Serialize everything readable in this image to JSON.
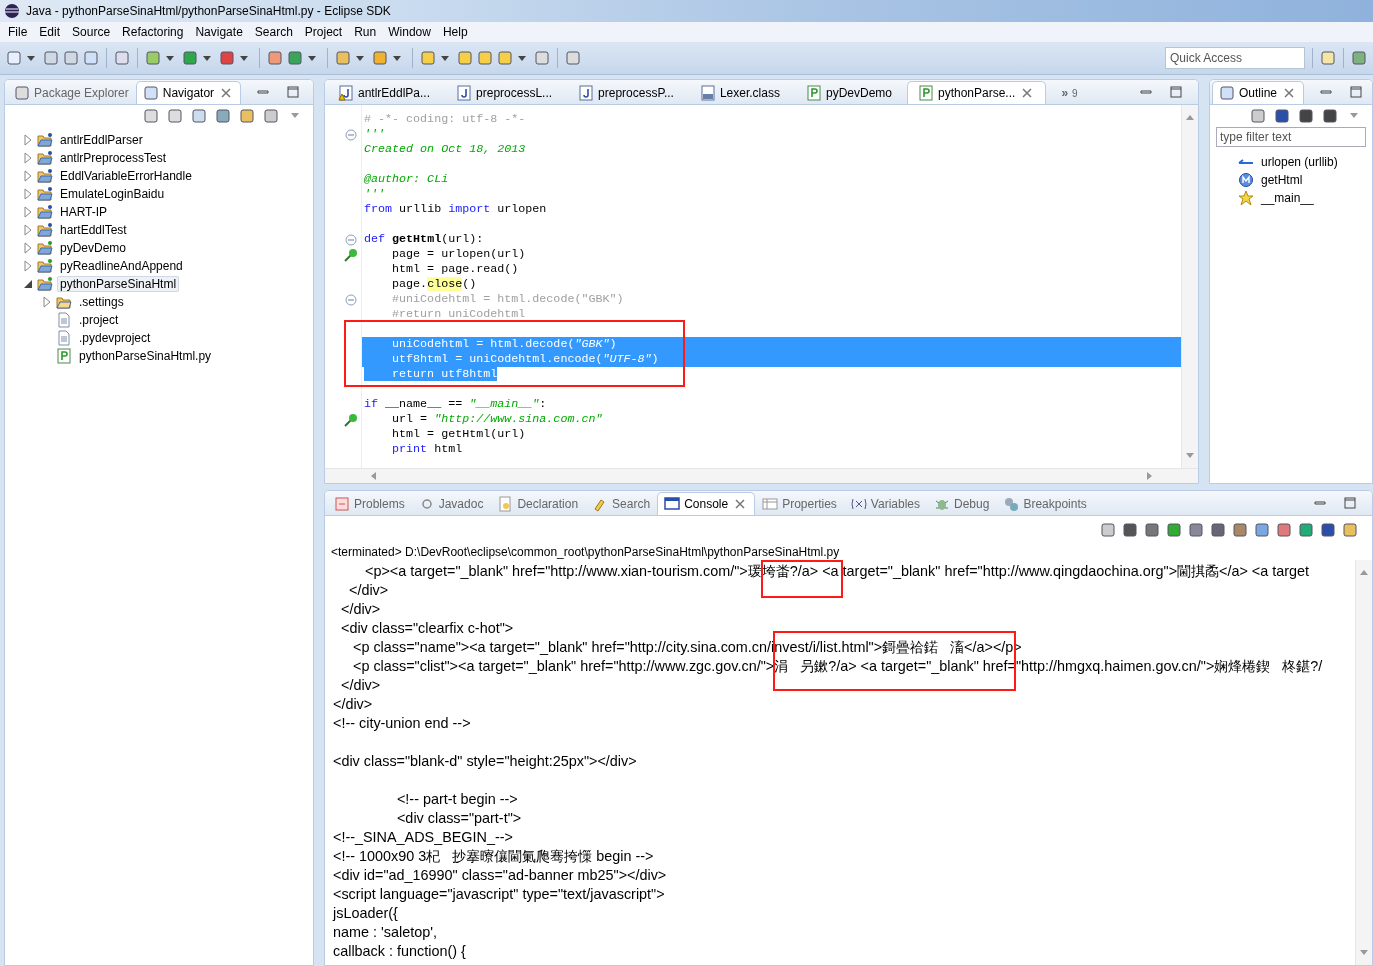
{
  "window": {
    "title": "Java - pythonParseSinaHtml/pythonParseSinaHtml.py - Eclipse SDK"
  },
  "menu": [
    "File",
    "Edit",
    "Source",
    "Refactoring",
    "Navigate",
    "Search",
    "Project",
    "Run",
    "Window",
    "Help"
  ],
  "quick_access": {
    "placeholder": "Quick Access"
  },
  "left_panel": {
    "tabs": [
      {
        "label": "Package Explorer",
        "selected": false
      },
      {
        "label": "Navigator",
        "selected": true
      }
    ],
    "tree": [
      {
        "label": "antlrEddlParser",
        "kind": "java-project",
        "expanded": false,
        "selected": false
      },
      {
        "label": "antlrPreprocessTest",
        "kind": "java-project",
        "expanded": false,
        "selected": false
      },
      {
        "label": "EddlVariableErrorHandle",
        "kind": "java-project",
        "expanded": false,
        "selected": false
      },
      {
        "label": "EmulateLoginBaidu",
        "kind": "java-project",
        "expanded": false,
        "selected": false
      },
      {
        "label": "HART-IP",
        "kind": "c-project",
        "expanded": false,
        "selected": false
      },
      {
        "label": "hartEddlTest",
        "kind": "java-project",
        "expanded": false,
        "selected": false
      },
      {
        "label": "pyDevDemo",
        "kind": "py-project",
        "expanded": false,
        "selected": false
      },
      {
        "label": "pyReadlineAndAppend",
        "kind": "py-project",
        "expanded": false,
        "selected": false
      },
      {
        "label": "pythonParseSinaHtml",
        "kind": "py-project",
        "expanded": true,
        "selected": true,
        "children": [
          {
            "label": ".settings",
            "kind": "folder",
            "expanded": false,
            "selected": false
          },
          {
            "label": ".project",
            "kind": "file",
            "selected": false
          },
          {
            "label": ".pydevproject",
            "kind": "file",
            "selected": false
          },
          {
            "label": "pythonParseSinaHtml.py",
            "kind": "py-file",
            "selected": false
          }
        ]
      }
    ]
  },
  "editor": {
    "tabs": [
      {
        "label": "antlrEddlPa...",
        "kind": "java-warn",
        "selected": false
      },
      {
        "label": "preprocessL...",
        "kind": "java",
        "selected": false
      },
      {
        "label": "preprocessP...",
        "kind": "java",
        "selected": false
      },
      {
        "label": "Lexer.class",
        "kind": "class",
        "selected": false
      },
      {
        "label": "pyDevDemo",
        "kind": "py",
        "selected": false
      },
      {
        "label": "pythonParse...",
        "kind": "py",
        "selected": true
      }
    ],
    "overflow": {
      "mark": "»",
      "count": "9"
    },
    "lines": [
      {
        "kind": "code",
        "selected": false,
        "segments": [
          {
            "text": "# -*- coding: utf-8 -*-",
            "kind": "comment"
          }
        ]
      },
      {
        "kind": "code",
        "selected": false,
        "gutter": {
          "kind": "fold"
        },
        "segments": [
          {
            "text": "'''",
            "kind": "docstring"
          }
        ]
      },
      {
        "kind": "code",
        "selected": false,
        "segments": [
          {
            "text": "Created on Oct 18, 2013",
            "kind": "docstring"
          }
        ]
      },
      {
        "kind": "blank"
      },
      {
        "kind": "code",
        "selected": false,
        "segments": [
          {
            "text": "@author: CLi",
            "kind": "docstring"
          }
        ]
      },
      {
        "kind": "code",
        "selected": false,
        "segments": [
          {
            "text": "'''",
            "kind": "docstring"
          }
        ]
      },
      {
        "kind": "code",
        "selected": false,
        "segments": [
          {
            "text": "from",
            "kind": "keyword"
          },
          {
            "text": " urllib ",
            "kind": "plain"
          },
          {
            "text": "import",
            "kind": "keyword"
          },
          {
            "text": " urlopen",
            "kind": "plain"
          }
        ]
      },
      {
        "kind": "blank"
      },
      {
        "kind": "code",
        "selected": false,
        "gutter": {
          "kind": "fold"
        },
        "segments": [
          {
            "text": "def ",
            "kind": "keyword"
          },
          {
            "text": "getHtml",
            "kind": "name"
          },
          {
            "text": "(url):",
            "kind": "plain"
          }
        ]
      },
      {
        "kind": "code",
        "selected": false,
        "gutter": {
          "kind": "marker"
        },
        "segments": [
          {
            "text": "    page = urlopen(url)",
            "kind": "plain"
          }
        ]
      },
      {
        "kind": "code",
        "selected": false,
        "segments": [
          {
            "text": "    html = page.read()",
            "kind": "plain"
          }
        ]
      },
      {
        "kind": "code",
        "selected": false,
        "segments": [
          {
            "text": "    page.",
            "kind": "plain"
          },
          {
            "text": "close",
            "kind": "occurrence"
          },
          {
            "text": "()",
            "kind": "plain"
          }
        ]
      },
      {
        "kind": "code",
        "selected": false,
        "gutter": {
          "kind": "fold"
        },
        "segments": [
          {
            "text": "    #uniCodehtml = html.decode(\"GBK\")",
            "kind": "comment"
          }
        ]
      },
      {
        "kind": "code",
        "selected": false,
        "segments": [
          {
            "text": "    #return uniCodehtml",
            "kind": "comment"
          }
        ]
      },
      {
        "kind": "blank"
      },
      {
        "kind": "code",
        "selected": true,
        "segments": [
          {
            "text": "    uniCodehtml = html.decode(",
            "kind": "plain"
          },
          {
            "text": "\"GBK\"",
            "kind": "string"
          },
          {
            "text": ")",
            "kind": "plain"
          }
        ]
      },
      {
        "kind": "code",
        "selected": true,
        "segments": [
          {
            "text": "    utf8html = uniCodehtml.encode(",
            "kind": "plain"
          },
          {
            "text": "\"UTF-8\"",
            "kind": "string"
          },
          {
            "text": ")",
            "kind": "plain"
          }
        ]
      },
      {
        "kind": "code",
        "selected": true,
        "segments": [
          {
            "text": "    return utf8html",
            "kind": "plain"
          }
        ]
      },
      {
        "kind": "blank"
      },
      {
        "kind": "code",
        "selected": false,
        "segments": [
          {
            "text": "if",
            "kind": "keyword"
          },
          {
            "text": " __name__ == ",
            "kind": "plain"
          },
          {
            "text": "\"__main__\"",
            "kind": "string"
          },
          {
            "text": ":",
            "kind": "plain"
          }
        ]
      },
      {
        "kind": "code",
        "selected": false,
        "gutter": {
          "kind": "marker"
        },
        "segments": [
          {
            "text": "    url = ",
            "kind": "plain"
          },
          {
            "text": "\"http://www.sina.com.cn\"",
            "kind": "string"
          }
        ]
      },
      {
        "kind": "code",
        "selected": false,
        "segments": [
          {
            "text": "    html = getHtml(url)",
            "kind": "plain"
          }
        ]
      },
      {
        "kind": "code",
        "selected": false,
        "segments": [
          {
            "text": "    print",
            "kind": "keyword"
          },
          {
            "text": " html",
            "kind": "plain"
          }
        ]
      }
    ]
  },
  "outline": {
    "tab": {
      "label": "Outline",
      "selected": true
    },
    "filter": {
      "placeholder": "type filter text"
    },
    "items": [
      {
        "label": "urlopen (urllib)",
        "kind": "import"
      },
      {
        "label": "getHtml",
        "kind": "method"
      },
      {
        "label": "__main__",
        "kind": "main"
      }
    ]
  },
  "bottom_panel": {
    "tabs": [
      {
        "label": "Problems",
        "kind": "problems",
        "selected": false
      },
      {
        "label": "Javadoc",
        "kind": "javadoc",
        "selected": false
      },
      {
        "label": "Declaration",
        "kind": "declaration",
        "selected": false
      },
      {
        "label": "Search",
        "kind": "search",
        "selected": false
      },
      {
        "label": "Console",
        "kind": "console",
        "selected": true
      },
      {
        "label": "Properties",
        "kind": "properties",
        "selected": false
      },
      {
        "label": "Variables",
        "kind": "variables",
        "selected": false
      },
      {
        "label": "Debug",
        "kind": "debug",
        "selected": false
      },
      {
        "label": "Breakpoints",
        "kind": "breakpoints",
        "selected": false
      }
    ],
    "console_header": "<terminated> D:\\DevRoot\\eclipse\\common_root\\pythonParseSinaHtml\\pythonParseSinaHtml.py",
    "console_lines": [
      {
        "kind": "text",
        "text": "        <p><a target=\"_blank\" href=\"http://www.xian-tourism.com/\">瑗垮畨?/a> <a target=\"_blank\" href=\"http://www.qingdaochina.org\">閫掑矞</a> <a target"
      },
      {
        "kind": "text",
        "text": "    </div>"
      },
      {
        "kind": "text",
        "text": "  </div>"
      },
      {
        "kind": "text",
        "text": "  <div class=\"clearfix c-hot\">"
      },
      {
        "kind": "text",
        "text": "     <p class=\"name\"><a target=\"_blank\" href=\"http://city.sina.com.cn/invest/i/list.html\">鎶曡祫鍩   滀</a></p>"
      },
      {
        "kind": "text",
        "text": "     <p class=\"clist\"><a target=\"_blank\" href=\"http://www.zgc.gov.cn/\">涓   叧鏉?/a> <a target=\"_blank\" href=\"http://hmgxq.haimen.gov.cn/\">娴烽棬鍥   柊鍖?/"
      },
      {
        "kind": "text",
        "text": "  </div>"
      },
      {
        "kind": "text",
        "text": "</div>"
      },
      {
        "kind": "text",
        "text": "<!-- city-union end -->"
      },
      {
        "kind": "blank"
      },
      {
        "kind": "text",
        "text": "<div class=\"blank-d\" style=\"height:25px\"></div>"
      },
      {
        "kind": "blank"
      },
      {
        "kind": "text",
        "text": "                <!-- part-t begin -->"
      },
      {
        "kind": "text",
        "text": "                <div class=\"part-t\">"
      },
      {
        "kind": "text",
        "text": "<!--_SINA_ADS_BEGIN_-->"
      },
      {
        "kind": "text",
        "text": "<!-- 1000x90 3杞   抄搴曢儴閫氭爮骞挎憡 begin -->"
      },
      {
        "kind": "text",
        "text": "<div id=\"ad_16990\" class=\"ad-banner mb25\"></div>"
      },
      {
        "kind": "text",
        "text": "<script language=\"javascript\" type=\"text/javascript\">"
      },
      {
        "kind": "text",
        "text": "jsLoader({"
      },
      {
        "kind": "text",
        "text": "name : 'saletop',"
      },
      {
        "kind": "text",
        "text": "callback : function() {"
      }
    ]
  }
}
